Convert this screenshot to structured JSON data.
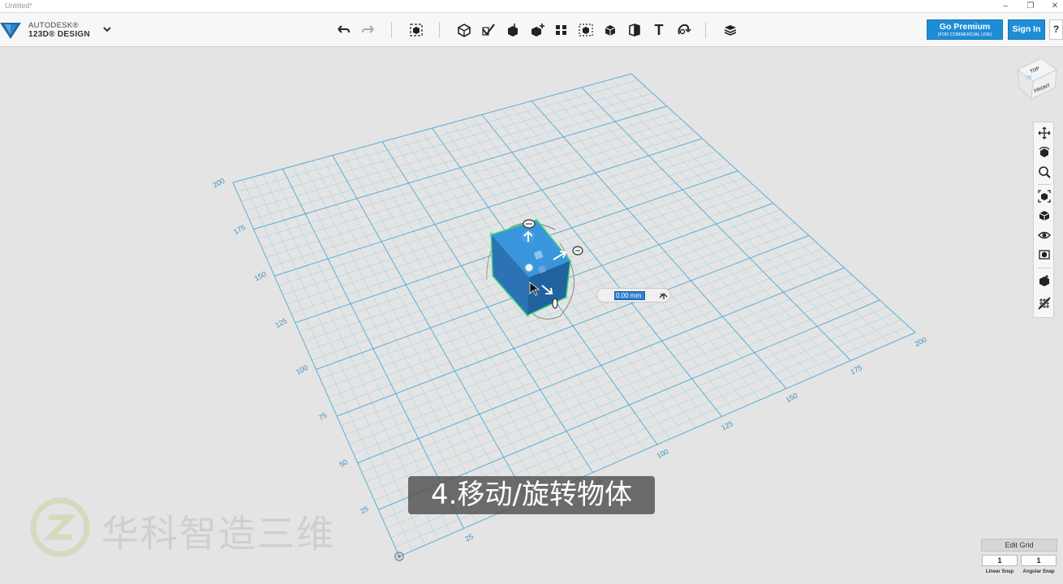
{
  "window": {
    "title": "Untitled*",
    "minimize_glyph": "–",
    "restore_glyph": "❐",
    "close_glyph": "✕"
  },
  "brand": {
    "company": "AUTODESK®",
    "product": "123D® DESIGN"
  },
  "toolbar": {
    "tools": [
      {
        "name": "undo-icon"
      },
      {
        "name": "redo-icon"
      },
      {
        "name": "transform-icon"
      },
      {
        "name": "primitives-icon"
      },
      {
        "name": "sketch-icon"
      },
      {
        "name": "construct-icon"
      },
      {
        "name": "modify-icon"
      },
      {
        "name": "pattern-icon"
      },
      {
        "name": "grouping-icon"
      },
      {
        "name": "combine-icon"
      },
      {
        "name": "measure-icon"
      },
      {
        "name": "text-icon"
      },
      {
        "name": "snap-icon"
      },
      {
        "name": "material-icon"
      }
    ],
    "text_tool_glyph": "T",
    "premium_label": "Go Premium",
    "premium_sub": "(FOR COMMERCIAL USE)",
    "signin_label": "Sign In",
    "help_label": "?"
  },
  "viewcube": {
    "top_label": "TOP",
    "front_label": "FRONT"
  },
  "grid": {
    "left_axis_labels": [
      "200",
      "175",
      "150",
      "125",
      "100",
      "75",
      "50",
      "25"
    ],
    "bottom_axis_labels": [
      "25",
      "75",
      "100",
      "125",
      "150",
      "175",
      "200"
    ]
  },
  "move_field": {
    "value": "0.00 mm"
  },
  "nav_bar": {
    "tools": [
      "pan-icon",
      "orbit-icon",
      "zoom-icon",
      "fit-icon",
      "view-mode-icon",
      "visibility-icon",
      "materials-icon",
      "outline-icon",
      "grid-toggle-icon"
    ]
  },
  "edit_grid": {
    "label": "Edit Grid",
    "linear_snap_value": "1",
    "angular_snap_value": "1",
    "linear_snap_label": "Linear Snap",
    "angular_snap_label": "Angular Snap"
  },
  "caption": {
    "text": "4.移动/旋转物体"
  },
  "watermark": {
    "text": "华科智造三维"
  },
  "colors": {
    "accent": "#1f8dd6",
    "grid_line": "#7cc4e6",
    "grid_major": "#4aa9d9",
    "cube_front": "#2a6fae",
    "cube_top": "#3a96dc",
    "cube_side": "#1f5d99",
    "selection": "#39d67a"
  }
}
